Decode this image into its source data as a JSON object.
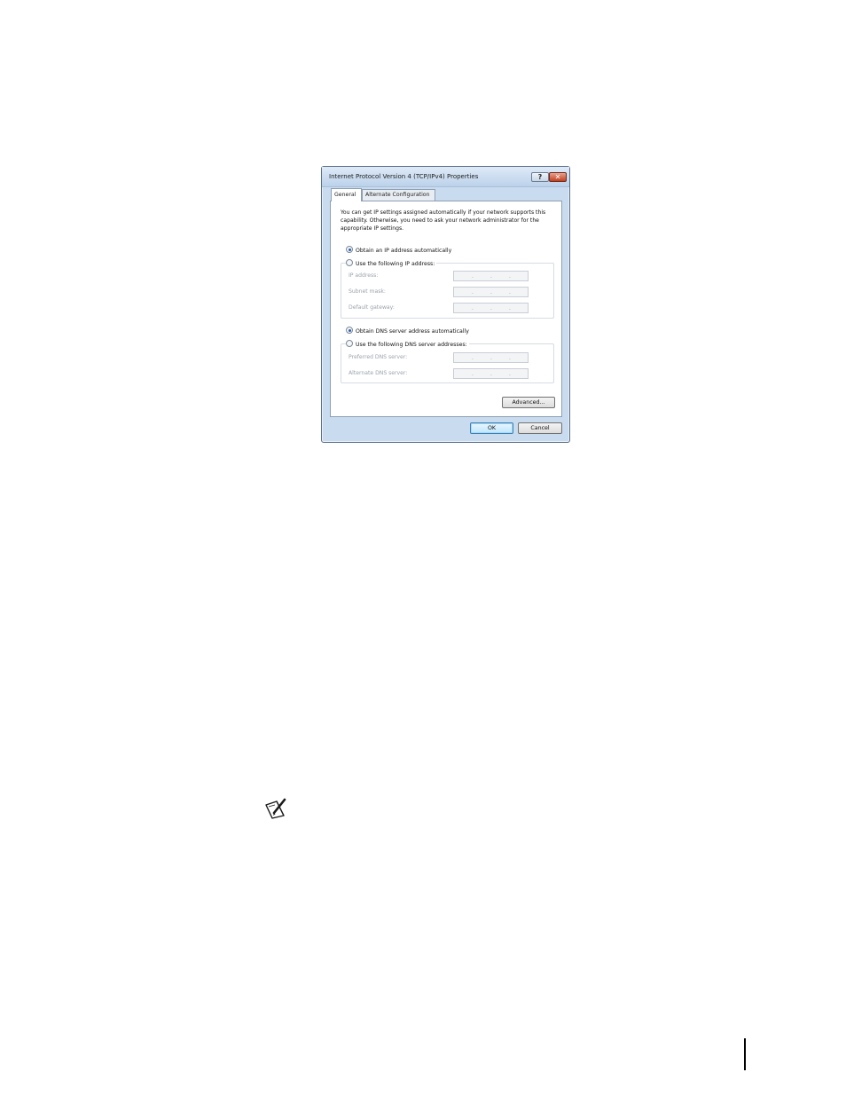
{
  "dialog": {
    "title": "Internet Protocol Version 4 (TCP/IPv4) Properties",
    "help_glyph": "?",
    "close_glyph": "✕"
  },
  "tabs": [
    {
      "label": "General",
      "selected": true
    },
    {
      "label": "Alternate Configuration",
      "selected": false
    }
  ],
  "general": {
    "intro": "You can get IP settings assigned automatically if your network supports this capability. Otherwise, you need to ask your network administrator for the appropriate IP settings.",
    "ip_auto_label": "Obtain an IP address automatically",
    "ip_manual_label": "Use the following IP address:",
    "ip_fields": [
      {
        "label": "IP address:"
      },
      {
        "label": "Subnet mask:"
      },
      {
        "label": "Default gateway:"
      }
    ],
    "dns_auto_label": "Obtain DNS server address automatically",
    "dns_manual_label": "Use the following DNS server addresses:",
    "dns_fields": [
      {
        "label": "Preferred DNS server:"
      },
      {
        "label": "Alternate DNS server:"
      }
    ],
    "ip_selection": "automatic",
    "dns_selection": "automatic",
    "address_separator": "."
  },
  "buttons": {
    "advanced": "Advanced...",
    "ok": "OK",
    "cancel": "Cancel"
  },
  "icons": {
    "note": "note-pencil-icon"
  },
  "colors": {
    "title_bar": "#c9dbef",
    "close_button": "#c4401f",
    "default_button_border": "#3c7fb1",
    "disabled_text": "#9aa3ad"
  }
}
